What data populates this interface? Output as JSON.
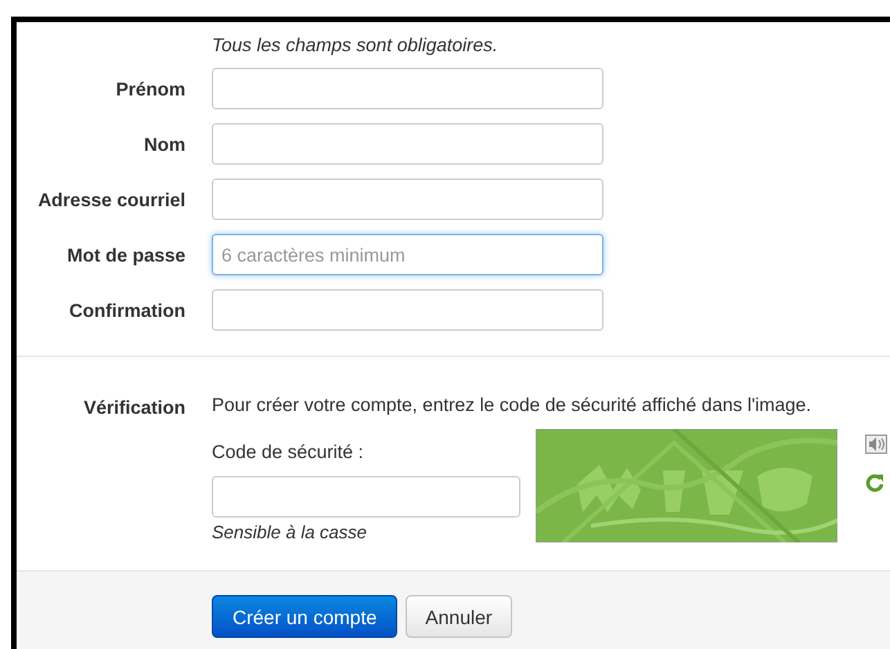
{
  "intro": "Tous les champs sont obligatoires.",
  "fields": [
    {
      "label": "Prénom",
      "focused": false
    },
    {
      "label": "Nom",
      "focused": false
    },
    {
      "label": "Adresse courriel",
      "focused": false
    },
    {
      "label": "Mot de passe",
      "placeholder": "6 caractères minimum",
      "focused": true
    },
    {
      "label": "Confirmation",
      "focused": false
    }
  ],
  "verification": {
    "label": "Vérification",
    "instructions": "Pour créer votre compte, entrez le code de sécurité affiché dans l'image.",
    "code_label": "Code de sécurité :",
    "hint": "Sensible à la casse"
  },
  "buttons": [
    {
      "label": "Créer un compte",
      "kind": "primary"
    },
    {
      "label": "Annuler",
      "kind": "default"
    }
  ]
}
